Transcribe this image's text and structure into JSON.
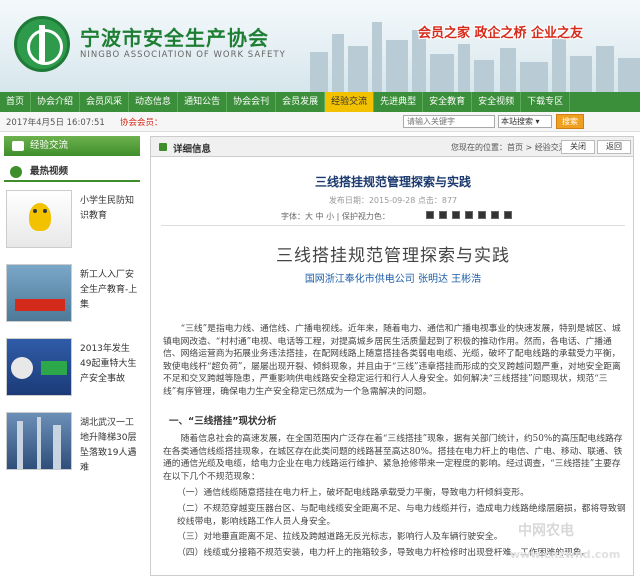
{
  "header": {
    "title": "宁波市安全生产协会",
    "subtitle": "NINGBO ASSOCIATION OF WORK SAFETY",
    "slogan": "会员之家 政企之桥 企业之友"
  },
  "nav": {
    "items": [
      "首页",
      "协会介绍",
      "会员风采",
      "动态信息",
      "通知公告",
      "协会会刊",
      "会员发展",
      "经验交流",
      "先进典型",
      "安全教育",
      "安全视频",
      "下载专区"
    ],
    "active_index": 7
  },
  "infobar": {
    "date": "2017年4月5日 16:07:51",
    "notice": "协会会员：",
    "search_placeholder": "请输入关键字",
    "search_scope": "本站搜索",
    "search_button": "搜索"
  },
  "left": {
    "tab": "经验交流",
    "section_title": "最热视频",
    "videos": [
      {
        "title": "小学生民防知识教育"
      },
      {
        "title": "新工人入厂安全生产教育-上集"
      },
      {
        "title": "2013年发生49起重特大生产安全事故"
      },
      {
        "title": "湖北武汉一工地升降梯30层坠落致19人遇难"
      }
    ]
  },
  "main": {
    "header": "详细信息",
    "breadcrumb": "您现在的位置：首页 > 经验交流",
    "close_label": "关闭",
    "back_label": "返回",
    "article_title": "三线搭挂规范管理探索与实践",
    "meta": "发布日期：2015-09-28  点击：877",
    "tools": "字体：大 中 小 | 保护视力色：",
    "big_title": "三线搭挂规范管理探索与实践",
    "author": "国网浙江奉化市供电公司  张明达  王彬浩",
    "para1": "“三线”是指电力线、通信线、广播电视线。近年来，随着电力、通信和广播电视事业的快速发展，特别是城区、城镇电网改造、“村村通”电视、电话等工程，对提高城乡居民生活质量起到了积极的推动作用。然而，各电话、广播通信、网络运营商为拓展业务违法搭挂，在配网线路上随意搭挂各类弱电电缆、光缆，破坏了配电线路的承载受力平衡，致使电线杆“超负荷”，屡屡出现开裂、倾斜现象，并且由于“三线”违章搭挂而形成的交叉跨越问题严重，对地安全距离不足和交叉跨越等隐患，严重影响供电线路安全稳定运行和行人人身安全。如何解决“三线搭挂”问题现状，规范“三线”有序管理，确保电力生产安全稳定已然成为一个急需解决的问题。",
    "section1": "一、“三线搭挂”现状分析",
    "para2": "随着信息社会的高速发展，在全国范围内广泛存在着“三线搭挂”现象，据有关部门统计，约50%的高压配电线路存在各类通信线缆搭挂现象，在城区存在此类问题的线路甚至高达80%。搭挂在电力杆上的电信、广电、移动、联通、铁通的通信光缆及电缆，给电力企业在电力线路运行维护、紧急抢修带来一定程度的影响。经过调查，“三线搭挂”主要存在以下几个不规范现象：",
    "item1": "（一）通信线缆随意搭挂在电力杆上，破坏配电线路承载受力平衡，导致电力杆倾斜变形。",
    "item2": "（二）不规范穿越变压器台区、与配电线缆安全距离不足、与电力线缆并行，造成电力线路绝缘层磨损，都将导致钢绞线带电，影响线路工作人员人身安全。",
    "item3": "（三）对地垂直距离不足、拉线及跨越道路无反光标志，影响行人及车辆行驶安全。",
    "item4": "（四）线缆或分接箱不规范安装，电力杆上的拖箱较多，导致电力杆检修时出现登杆难、工作困难的现象。"
  },
  "watermark": {
    "text": "中网农电",
    "url": "www.cnzwnd.com"
  }
}
